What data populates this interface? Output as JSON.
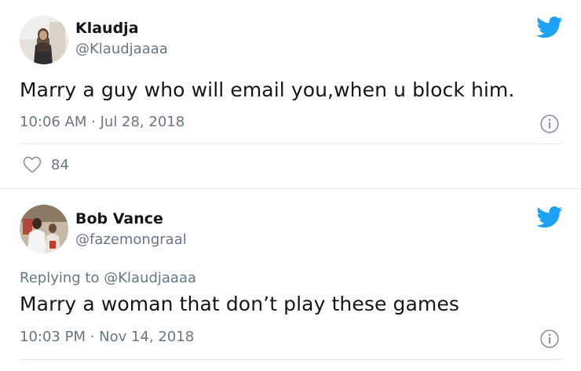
{
  "tweets": [
    {
      "name": "Klaudja",
      "handle": "@Klaudjaaaa",
      "text": "Marry a guy who will email you,when u block him.",
      "timestamp": "10:06 AM · Jul 28, 2018",
      "likes": "84"
    },
    {
      "name": "Bob Vance",
      "handle": "@fazemongraal",
      "replying_to_label": "Replying to",
      "replying_to_handle": "@Klaudjaaaa",
      "text": "Marry a woman that don’t play these games",
      "timestamp": "10:03 PM · Nov 14, 2018"
    }
  ],
  "colors": {
    "twitter_blue": "#1da1f2",
    "secondary_text": "#657786",
    "primary_text": "#14171a"
  },
  "icons": {
    "brand": "twitter-bird-icon",
    "info": "info-icon",
    "like": "heart-icon"
  }
}
